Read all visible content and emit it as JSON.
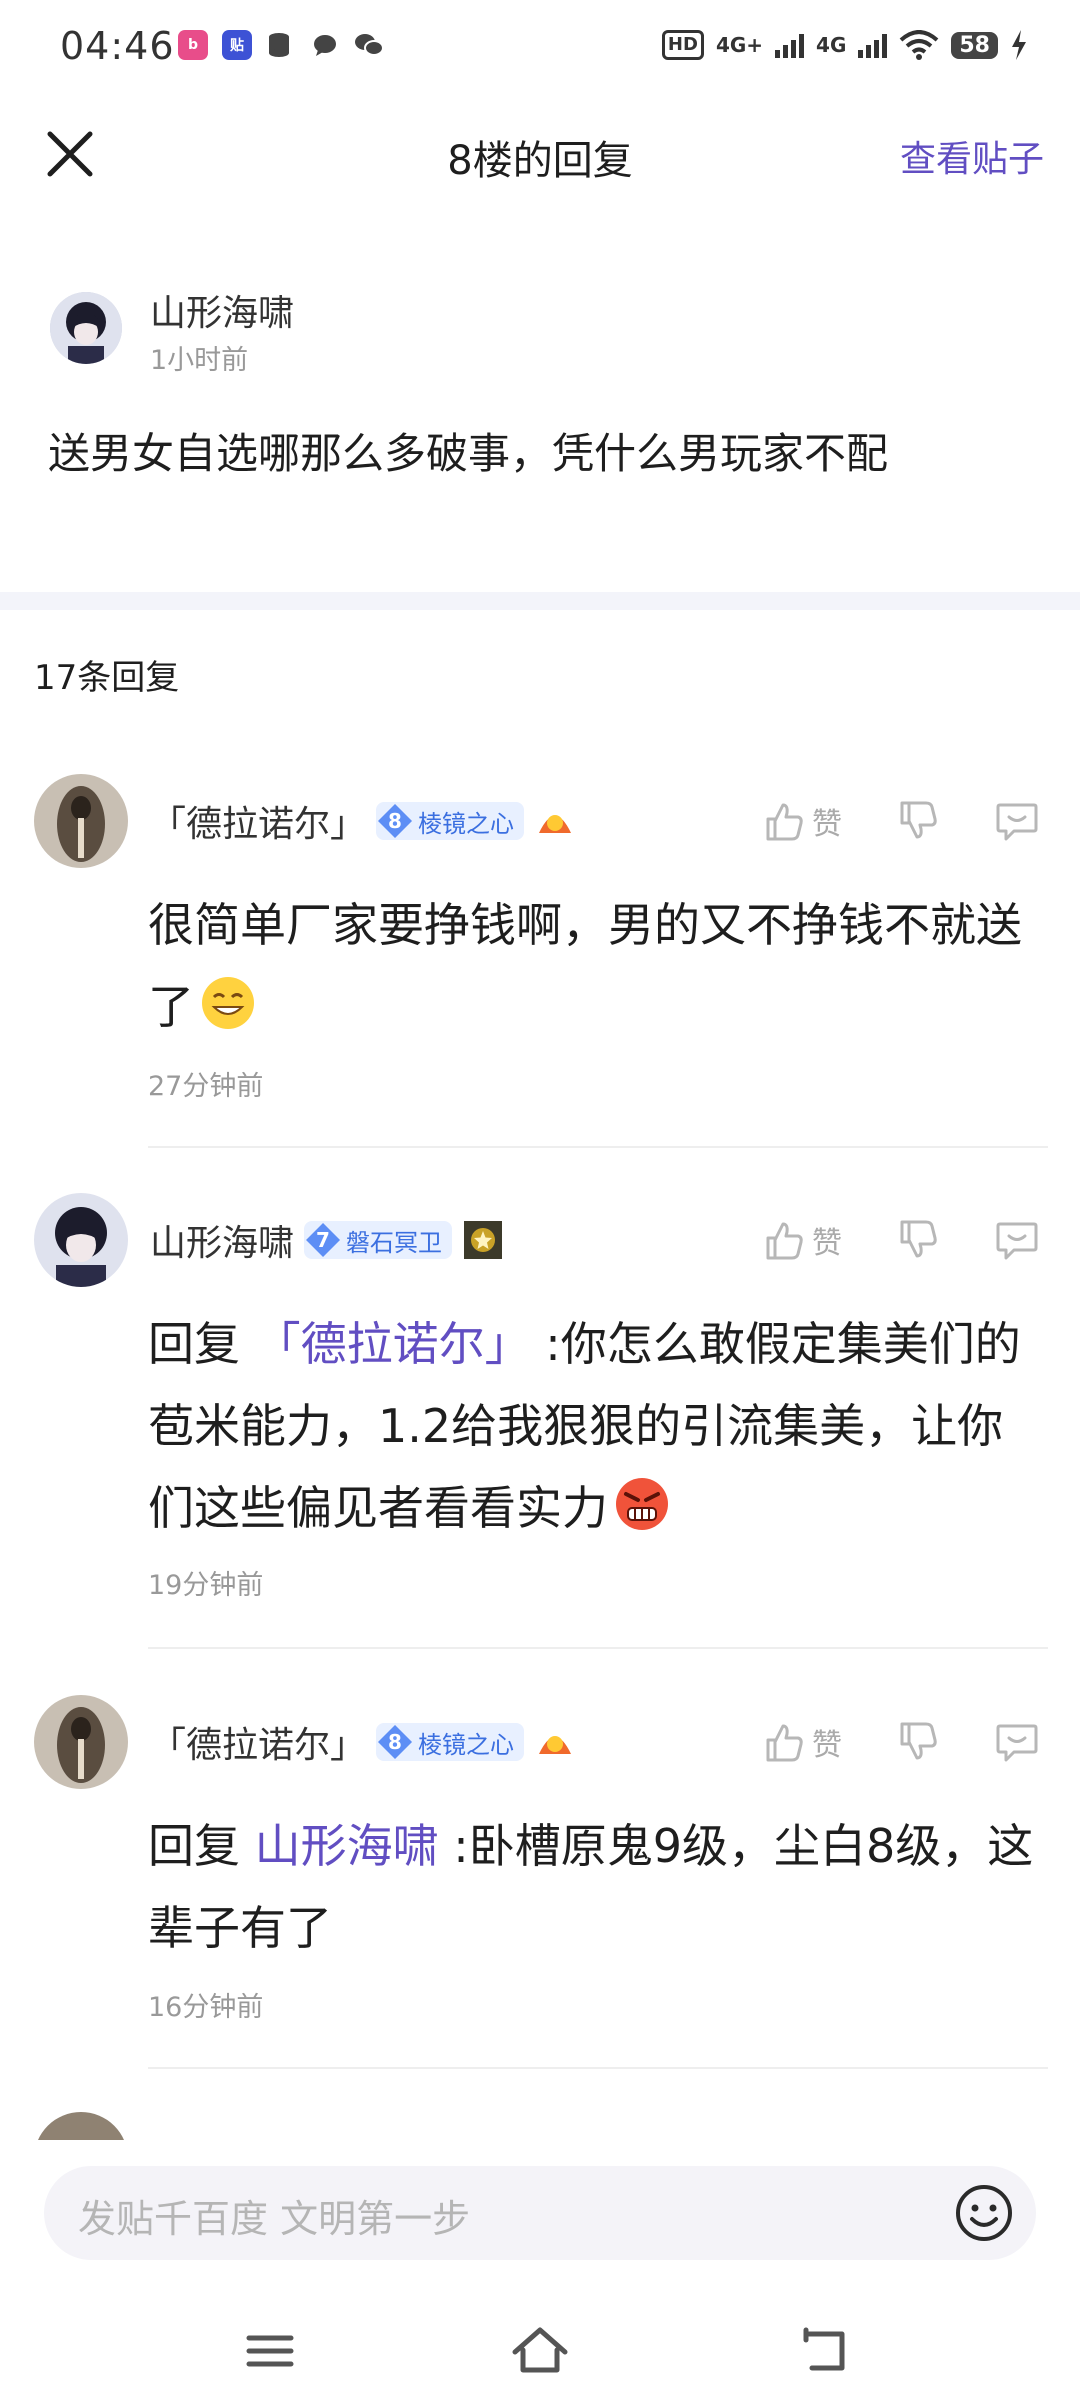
{
  "status_bar": {
    "time": "04:46",
    "signal_1": "4G+",
    "signal_2": "4G",
    "battery": "58",
    "hd": "HD"
  },
  "header": {
    "title": "8楼的回复",
    "view_post": "查看贴子"
  },
  "main_post": {
    "author": "山形海啸",
    "time": "1小时前",
    "content": "送男女自选哪那么多破事，凭什么男玩家不配"
  },
  "reply_count": "17条回复",
  "replies": [
    {
      "author": "「德拉诺尔」",
      "level": "8",
      "badge": "棱镜之心",
      "like_label": "赞",
      "text": "很简单厂家要挣钱啊，男的又不挣钱不就送了",
      "time": "27分钟前"
    },
    {
      "author": "山形海啸",
      "level": "7",
      "badge": "磐石冥卫",
      "like_label": "赞",
      "reply_prefix": "回复",
      "reply_to": "「德拉诺尔」",
      "text": ":你怎么敢假定集美们的苞米能力，1.2给我狠狠的引流集美，让你们这些偏见者看看实力",
      "time": "19分钟前"
    },
    {
      "author": "「德拉诺尔」",
      "level": "8",
      "badge": "棱镜之心",
      "like_label": "赞",
      "reply_prefix": "回复",
      "reply_to": "山形海啸",
      "text": ":卧槽原鬼9级，尘白8级，这辈子有了",
      "time": "16分钟前"
    }
  ],
  "input": {
    "placeholder": "发贴千百度 文明第一步"
  },
  "colors": {
    "accent": "#614ec2",
    "badge_blue": "#3b6fe0",
    "muted": "#999999"
  }
}
